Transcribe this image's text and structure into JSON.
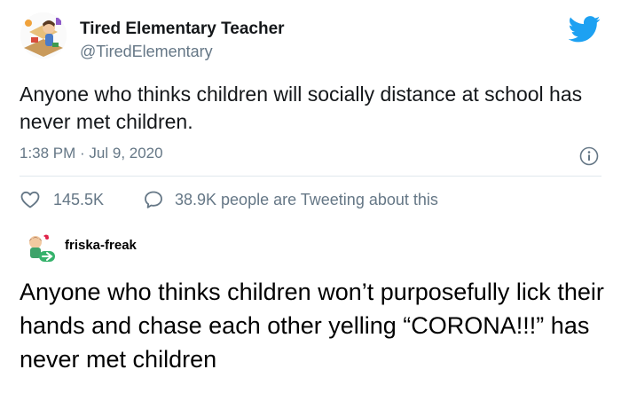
{
  "tweet": {
    "display_name": "Tired Elementary Teacher",
    "handle": "@TiredElementary",
    "text": "Anyone who thinks children will socially distance at school has never met children.",
    "timestamp": "1:38 PM · Jul 9, 2020",
    "like_count": "145.5K",
    "reply_text": "38.9K people are Tweeting about this",
    "brand_color": "#1da1f2",
    "icons": {
      "logo": "twitter-bird-icon",
      "info": "info-icon",
      "like": "heart-icon",
      "reply": "speech-bubble-icon"
    }
  },
  "tumblr": {
    "username": "friska-freak",
    "text": "Anyone who thinks children won’t purposefully lick their hands and chase each other yelling “CORONA!!!” has never met children"
  }
}
